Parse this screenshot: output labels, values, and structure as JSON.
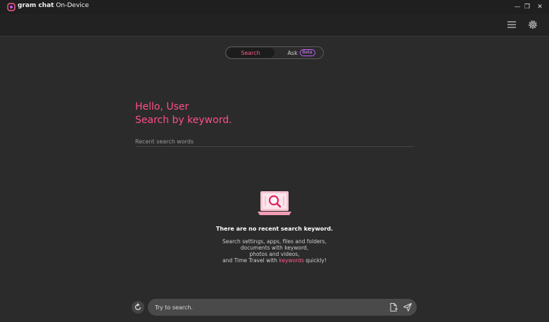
{
  "app": {
    "name_bold": "gram chat",
    "name_rest": " On-Device"
  },
  "window_controls": {
    "minimize": "—",
    "restore": "❐",
    "close": "✕"
  },
  "header": {
    "menu_icon": "hamburger-menu-icon",
    "settings_icon": "gear-icon"
  },
  "mode_toggle": {
    "search_label": "Search",
    "ask_label": "Ask",
    "beta_badge": "Beta",
    "active": "Search"
  },
  "main": {
    "greeting": "Hello, User",
    "subgreeting": "Search by keyword.",
    "recent_label": "Recent search words"
  },
  "empty_state": {
    "title": "There are no recent search keyword.",
    "desc_line1": "Search settings, apps, files and folders,",
    "desc_line2": "documents with keyword,",
    "desc_line3": "photos and videos,",
    "desc_line4_prefix": "and Time Travel with ",
    "desc_line4_keyword": "keywords",
    "desc_line4_suffix": " quickly!"
  },
  "search_bar": {
    "placeholder": "Try to search."
  },
  "colors": {
    "accent": "#ff4f86",
    "background": "#2b2b2b",
    "titlebar": "#1f1f1f",
    "beta": "#c35cff"
  }
}
